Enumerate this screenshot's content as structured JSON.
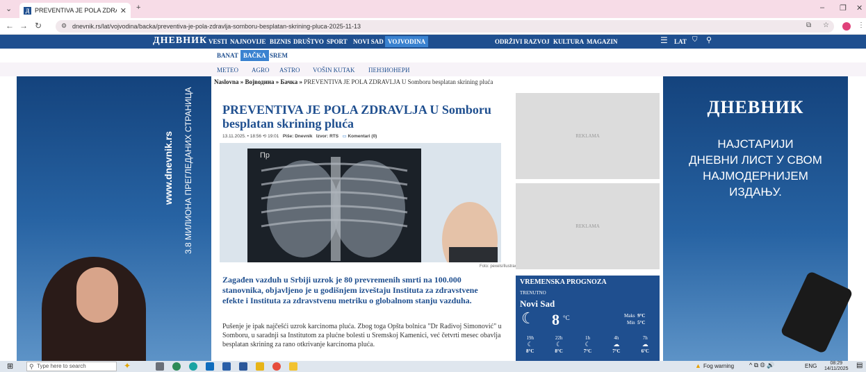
{
  "browser": {
    "tab_title": "PREVENTIVA JE POLA ZDRAVLJ",
    "favicon_letter": "Д",
    "url": "dnevnik.rs/lat/vojvodina/backa/preventiva-je-pola-zdravlja-somboru-besplatan-skrining-pluca-2025-11-13"
  },
  "site": {
    "logo": "ДНЕВНИК",
    "nav": [
      "VESTI",
      "NAJNOVIJE",
      "BIZNIS",
      "DRUŠTVO",
      "SPORT",
      "NOVI SAD",
      "VOJVODINA",
      "ODRŽIVI RAZVOJ",
      "KULTURA",
      "MAGAZIN"
    ],
    "lang": "LAT",
    "subnav": [
      "BANAT",
      "BAČKA",
      "SREM"
    ],
    "subnav2": [
      "METEO",
      "AGRO",
      "ASTRO",
      "VOŠIN KUTAK",
      "ПЕНЗИОНЕРИ"
    ]
  },
  "breadcrumb": {
    "home": "Naslovna",
    "sep": "»",
    "region": "Војводина",
    "area": "Бачка",
    "current": "PREVENTIVA JE POLA ZDRAVLJA U Somboru besplatan skrining pluća"
  },
  "article": {
    "headline": "PREVENTIVA JE POLA ZDRAVLJA U Somboru besplatan skrining pluća",
    "date": "13.11.2025.",
    "time": "18:56",
    "updated": "19:01",
    "author_label": "Piše:",
    "author": "Dnevnik",
    "source_label": "Izvor:",
    "source": "RTS",
    "comments": "Komentari (0)",
    "photo_caption": "Foto: pexels/Ilustracija",
    "photo_mark": "Пр",
    "lead": "Zagađen vazduh u Srbiji uzrok je 80 prevremenih smrti na 100.000 stanovnika, objavljeno je u godišnjem izveštaju Instituta za zdravstvene efekte i Instituta za zdravstvenu metriku o globalnom stanju vazduha.",
    "body": "Pušenje je ipak najčešći uzrok karcinoma pluća. Zbog toga Opšta bolnica \"Dr Radivoj Simonović\" u Somboru, u saradnji sa Institutom za plućne bolesti u Sremskoj Kamenici, već četvrti mesec obavlja besplatan skrining za rano otkrivanje karcinoma pluća."
  },
  "ads": {
    "label": "REKLAMA"
  },
  "weather": {
    "title": "VREMENSKA PROGNOZA",
    "now_label": "TRENUTNO",
    "city": "Novi Sad",
    "temp": "8",
    "unit": "°C",
    "max_label": "Maks",
    "max": "9°C",
    "min_label": "Min",
    "min": "5°C",
    "hours": [
      {
        "h": "19h",
        "t": "8°C",
        "icon": "moon-icon"
      },
      {
        "h": "22h",
        "t": "8°C",
        "icon": "moon-icon"
      },
      {
        "h": "1h",
        "t": "7°C",
        "icon": "moon-icon"
      },
      {
        "h": "4h",
        "t": "7°C",
        "icon": "cloud-icon"
      },
      {
        "h": "7h",
        "t": "6°C",
        "icon": "cloud-icon"
      }
    ]
  },
  "left_banner": {
    "url": "www.dnevnik.rs",
    "tagline": "3.8 МИЛИОНА ПРЕГЛЕДАНИХ СТРАНИЦА"
  },
  "right_banner": {
    "logo": "ДНЕВНИК",
    "line1": "НАЈСТАРИЈИ",
    "line2": "ДНЕВНИ ЛИСТ У СВОМ",
    "line3": "НАЈМОДЕРНИЈЕМ",
    "line4": "ИЗДАЊУ."
  },
  "taskbar": {
    "search_placeholder": "Type here to search",
    "weather_alert": "Fog warning",
    "lang": "ENG",
    "time": "08:29",
    "date": "14/11/2025"
  }
}
